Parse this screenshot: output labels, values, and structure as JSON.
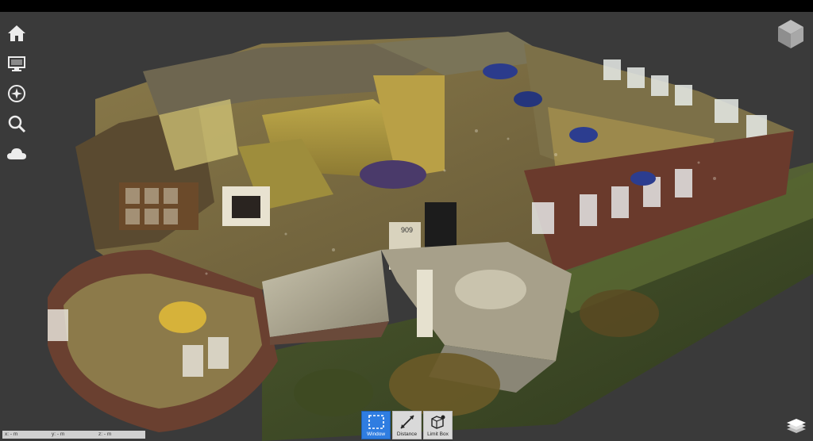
{
  "toolbar_left": {
    "items": [
      {
        "name": "home",
        "icon": "home-icon"
      },
      {
        "name": "display",
        "icon": "monitor-icon"
      },
      {
        "name": "navigate",
        "icon": "compass-icon"
      },
      {
        "name": "search",
        "icon": "search-icon"
      },
      {
        "name": "cloud",
        "icon": "cloud-icon"
      }
    ]
  },
  "bottom_toolbar": {
    "window_label": "Window",
    "distance_label": "Distance",
    "limit_box_label": "Limit Box"
  },
  "coords": {
    "x": "x: - m",
    "y": "y: - m",
    "z": "z: - m"
  },
  "scene": {
    "house_number": "909"
  },
  "colors": {
    "viewport_bg": "#3a3a3a",
    "active_tool": "#2f7de1"
  }
}
